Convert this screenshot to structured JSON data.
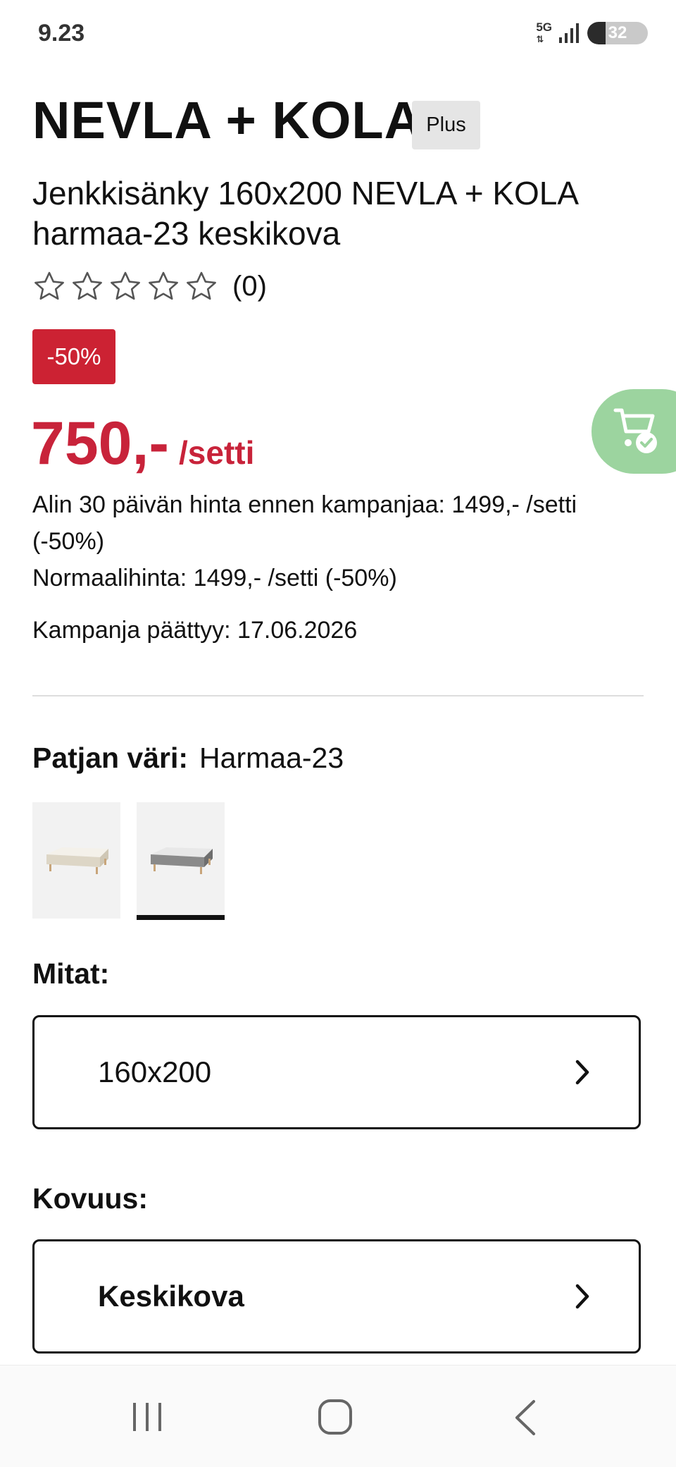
{
  "status_bar": {
    "time": "9.23",
    "network": "5G",
    "battery": "32"
  },
  "product": {
    "name": "NEVLA + KOLA",
    "badge": "Plus",
    "description": "Jenkkisänky 160x200 NEVLA + KOLA harmaa-23 keskikova",
    "rating_count": "(0)",
    "stars_filled": 0,
    "stars_total": 5
  },
  "pricing": {
    "discount_badge": "-50%",
    "price": "750,-",
    "unit": "/setti",
    "lowest_price_text": "Alin 30 päivän hinta ennen kampanjaa: 1499,- /setti (-50%)",
    "normal_price_text": "Normaalihinta: 1499,- /setti (-50%)",
    "campaign_end_text": "Kampanja päättyy: 17.06.2026",
    "accent_color": "#cc2233"
  },
  "cart_button": {
    "icon": "cart-check-icon",
    "color": "#9cd49f"
  },
  "options": {
    "color_label": "Patjan väri:",
    "color_value": "Harmaa-23",
    "swatches": [
      {
        "name": "beige bed",
        "color": "#e2dccf",
        "selected": false
      },
      {
        "name": "grey bed",
        "color": "#8a8a8a",
        "selected": true
      }
    ],
    "size_label": "Mitat:",
    "size_value": "160x200",
    "firmness_label": "Kovuus:",
    "firmness_value": "Keskikova"
  },
  "nav": {
    "recent_icon": "recent-apps-icon",
    "home_icon": "home-icon",
    "back_icon": "back-icon"
  }
}
